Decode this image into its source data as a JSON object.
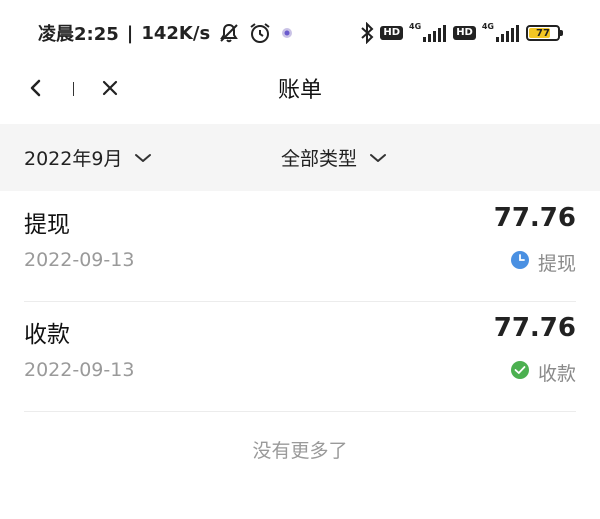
{
  "status_bar": {
    "time": "凌晨2:25",
    "separator": "|",
    "net_speed": "142K/s",
    "hd_label_1": "HD",
    "hd_label_2": "HD",
    "network_type_1": "4G",
    "network_type_2": "4G",
    "battery_level": "77",
    "battery_fraction": 0.77,
    "icons": [
      "bell-off-icon",
      "alarm-icon",
      "app-notification-icon",
      "bluetooth-icon",
      "signal-icon",
      "battery-icon"
    ]
  },
  "nav": {
    "title": "账单",
    "back_icon": "chevron-left-icon",
    "close_icon": "close-icon"
  },
  "filters": {
    "date": "2022年9月",
    "type": "全部类型",
    "dropdown_icon": "chevron-down-icon"
  },
  "bills": [
    {
      "title": "提现",
      "date": "2022-09-13",
      "amount": "77.76",
      "status": "提现",
      "status_icon": "clock-icon",
      "status_color": "#4a90e2"
    },
    {
      "title": "收款",
      "date": "2022-09-13",
      "amount": "77.76",
      "status": "收款",
      "status_icon": "check-circle-icon",
      "status_color": "#4cb050"
    }
  ],
  "footer": {
    "no_more": "没有更多了"
  }
}
